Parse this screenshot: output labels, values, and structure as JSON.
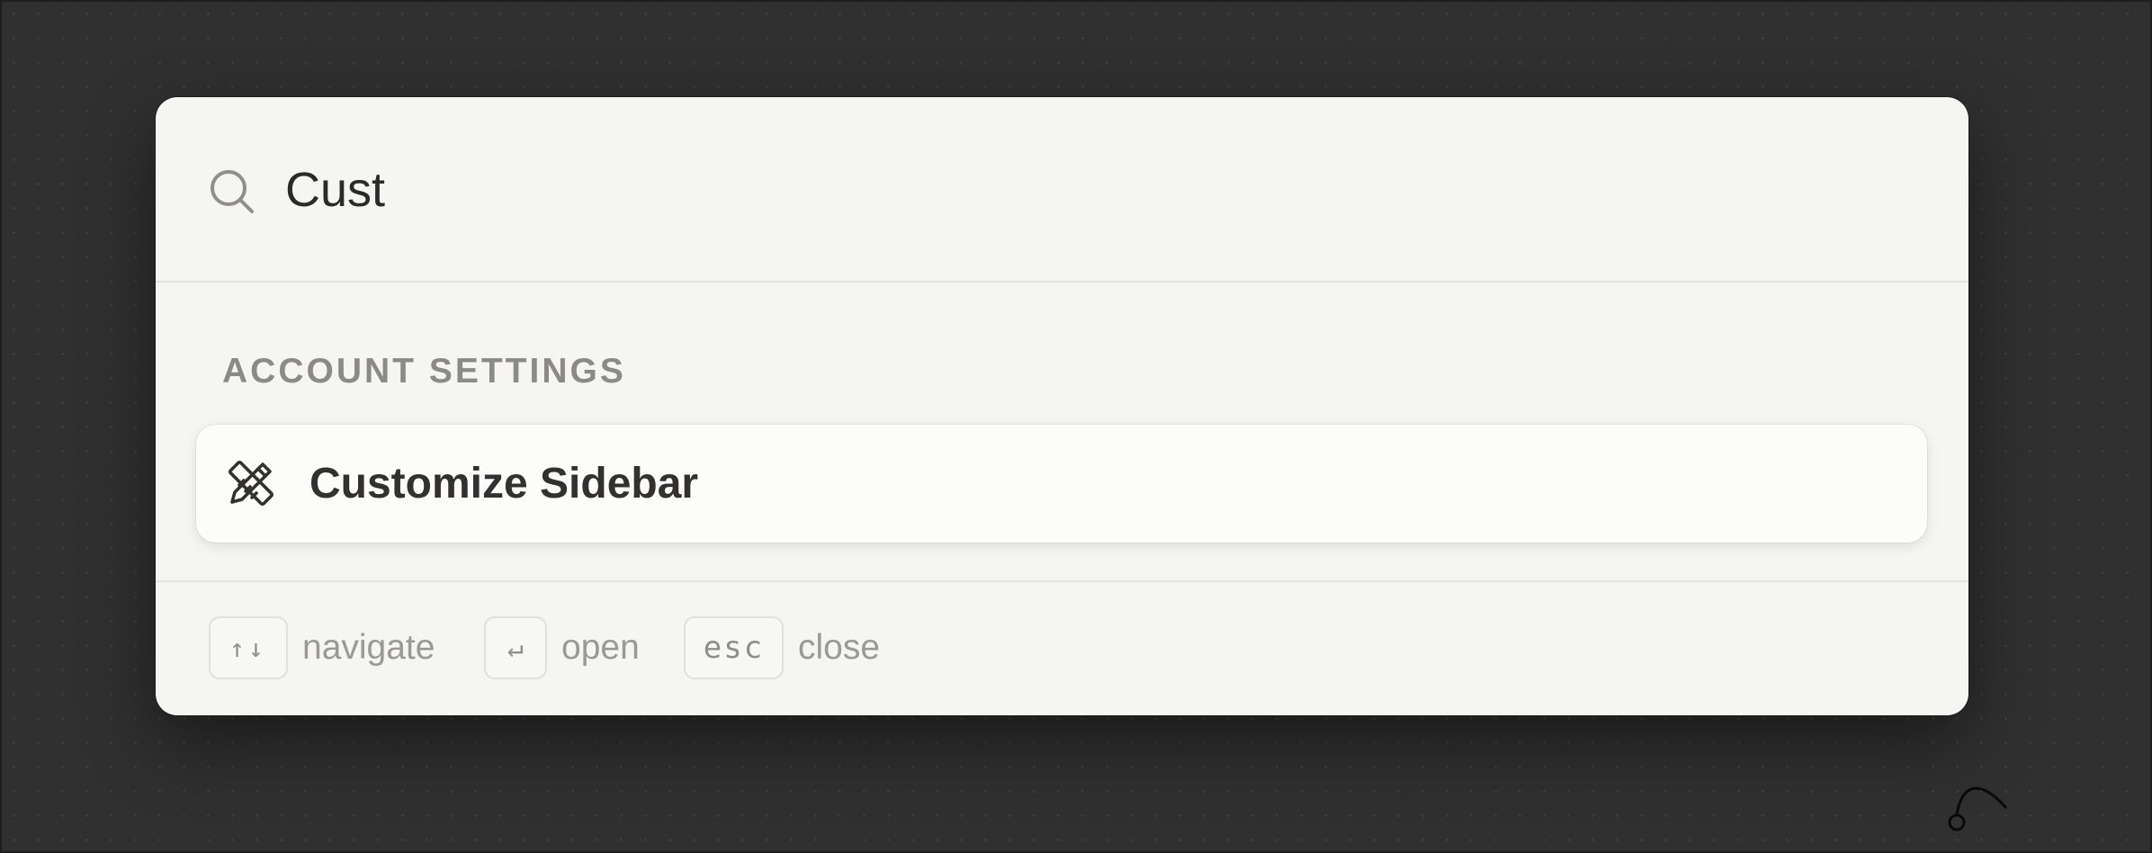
{
  "search": {
    "query": "Cust",
    "icon": "search-icon"
  },
  "results": {
    "group_label": "ACCOUNT SETTINGS",
    "items": [
      {
        "label": "Customize Sidebar",
        "icon": "pencil-ruler-icon"
      }
    ]
  },
  "footer": {
    "hints": [
      {
        "key": "↑↓",
        "label": "navigate"
      },
      {
        "key": "↵",
        "label": "open"
      },
      {
        "key": "esc",
        "label": "close"
      }
    ]
  },
  "colors": {
    "backdrop": "#303030",
    "palette_bg": "#f5f5f3",
    "text_primary": "#2b2a28",
    "text_muted": "#8b8a86"
  }
}
